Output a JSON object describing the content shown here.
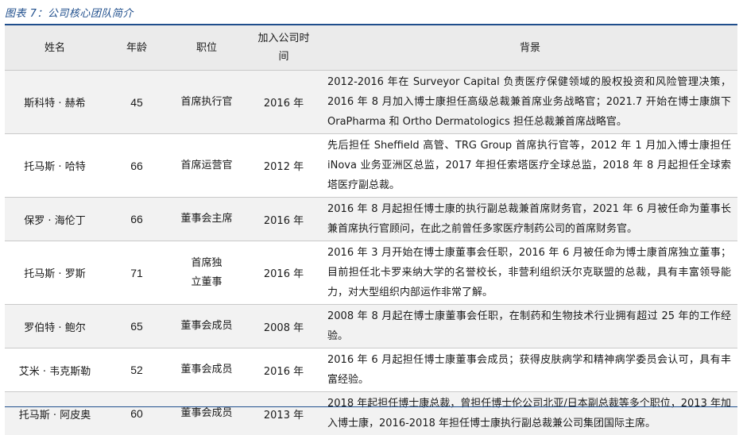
{
  "title": "图表 7：公司核心团队简介",
  "table": {
    "headers": {
      "name": "姓名",
      "age": "年龄",
      "position": "职位",
      "joined": "加入公司时间",
      "background": "背景"
    },
    "rows": [
      {
        "name": "斯科特 · 赫希",
        "age": "45",
        "position": "首席执行官",
        "joined": "2016 年",
        "background": "2012-2016 年在 Surveyor Capital 负责医疗保健领域的股权投资和风险管理决策，2016 年 8 月加入博士康担任高级总裁兼首席业务战略官；2021.7 开始在博士康旗下 OraPharma 和 Ortho Dermatologics 担任总裁兼首席战略官。"
      },
      {
        "name": "托马斯 · 哈特",
        "age": "66",
        "position": "首席运营官",
        "joined": "2012 年",
        "background": "先后担任 Sheffield 高管、TRG Group 首席执行官等，2012 年 1 月加入博士康担任 iNova 业务亚洲区总监，2017 年担任索塔医疗全球总监，2018 年 8 月起担任全球索塔医疗副总裁。"
      },
      {
        "name": "保罗 · 海伦丁",
        "age": "66",
        "position": "董事会主席",
        "joined": "2016 年",
        "background": "2016 年 8 月起担任博士康的执行副总裁兼首席财务官，2021 年 6 月被任命为董事长兼首席执行官顾问，在此之前曾任多家医疗制药公司的首席财务官。"
      },
      {
        "name": "托马斯 · 罗斯",
        "age": "71",
        "position": "首席独立董事",
        "joined": "2016 年",
        "background": "2016 年 3 月开始在博士康董事会任职，2016 年 6 月被任命为博士康首席独立董事；目前担任北卡罗来纳大学的名誉校长，非营利组织沃尔克联盟的总裁，具有丰富领导能力，对大型组织内部运作非常了解。"
      },
      {
        "name": "罗伯特 · 鲍尔",
        "age": "65",
        "position": "董事会成员",
        "joined": "2008 年",
        "background": "2008 年 8 月起在博士康董事会任职，在制药和生物技术行业拥有超过 25 年的工作经验。"
      },
      {
        "name": "艾米 · 韦克斯勒",
        "age": "52",
        "position": "董事会成员",
        "joined": "2016 年",
        "background": "2016 年 6 月起担任博士康董事会成员；获得皮肤病学和精神病学委员会认可，具有丰富经验。"
      },
      {
        "name": "托马斯 · 阿皮奥",
        "age": "60",
        "position": "董事会成员",
        "joined": "2013 年",
        "background": "2018 年起担任博士康总裁，曾担任博士伦公司北亚/日本副总裁等多个职位，2013 年加入博士康，2016-2018 年担任博士康执行副总裁兼公司集团国际主席。"
      }
    ]
  }
}
